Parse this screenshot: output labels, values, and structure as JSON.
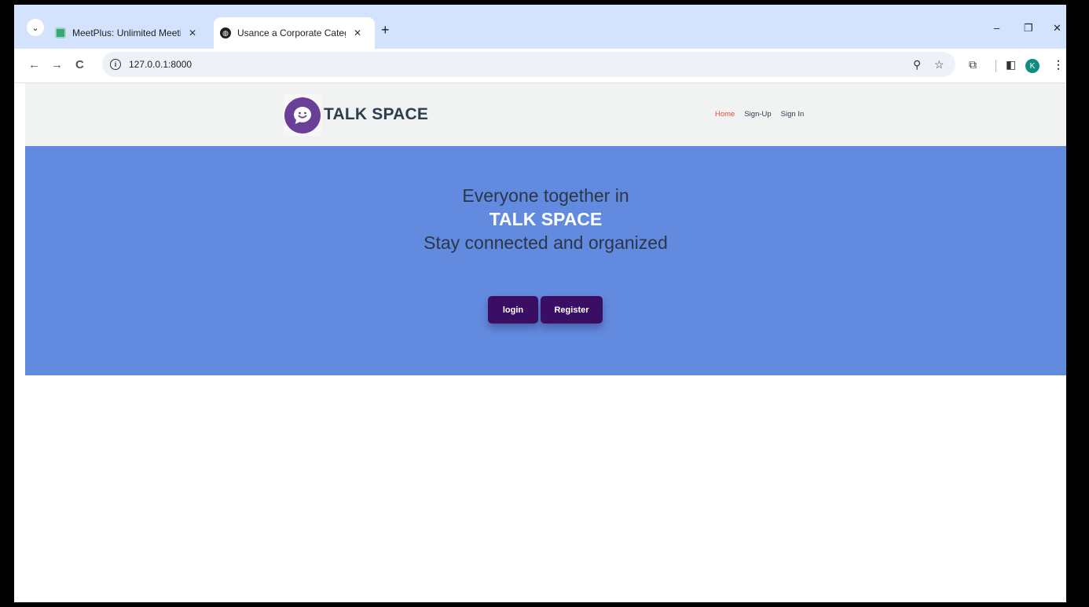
{
  "browser": {
    "tabs": [
      {
        "title": "MeetPlus: Unlimited Meetings",
        "close": "✕"
      },
      {
        "title": "Usance a Corporate Category B",
        "close": "✕"
      }
    ],
    "new_tab": "+",
    "url": "127.0.0.1:8000",
    "profile_initial": "K",
    "window_controls": {
      "minimize": "–",
      "restore": "❐",
      "close": "✕"
    },
    "nav": {
      "back": "←",
      "forward": "→",
      "reload": "C"
    }
  },
  "site": {
    "brand": "TALK SPACE",
    "nav": [
      {
        "label": "Home",
        "active": true
      },
      {
        "label": "Sign-Up",
        "active": false
      },
      {
        "label": "Sign In",
        "active": false
      }
    ]
  },
  "hero": {
    "line1": "Everyone together in",
    "line2": "TALK SPACE",
    "line3": "Stay connected and organized",
    "login_label": "login",
    "register_label": "Register"
  },
  "colors": {
    "hero_bg": "#628be0",
    "button_bg": "#3a0e63",
    "logo": "#6a3f98",
    "nav_active": "#e74c3c"
  }
}
